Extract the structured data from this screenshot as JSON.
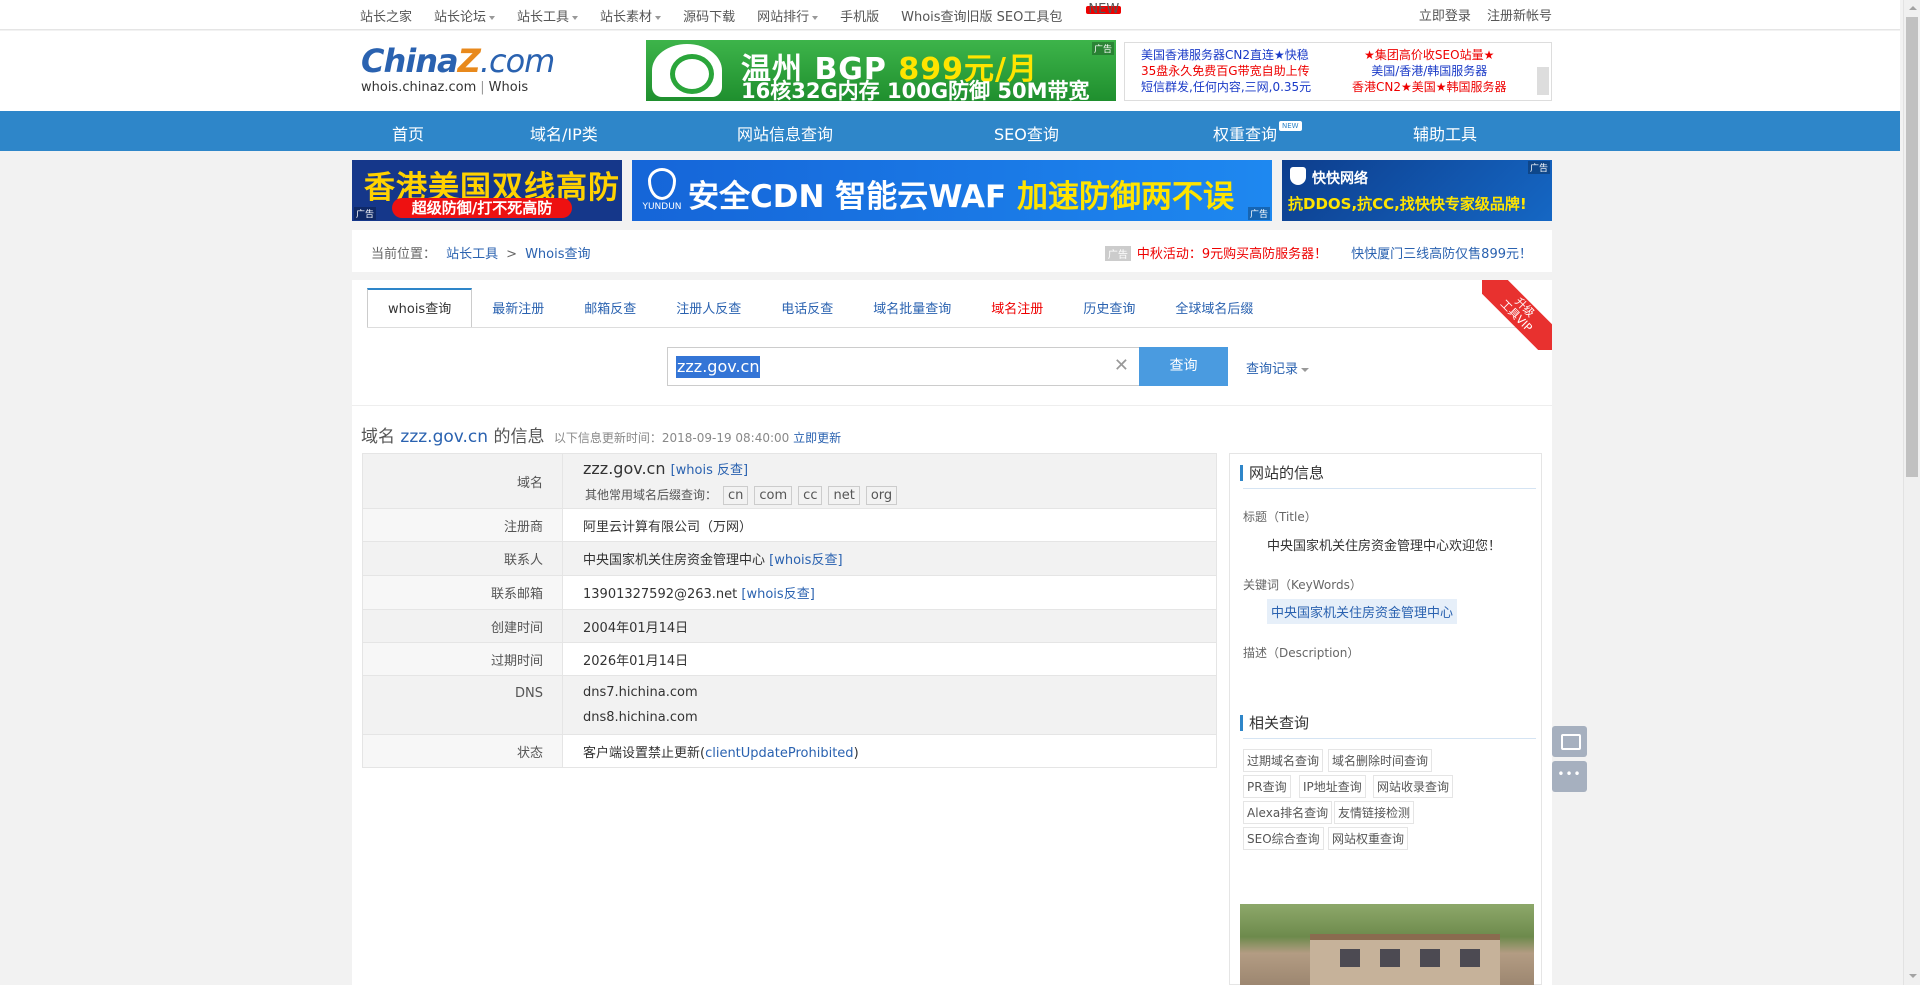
{
  "topbar": {
    "links": [
      {
        "label": "站长之家",
        "dropdown": false
      },
      {
        "label": "站长论坛",
        "dropdown": true
      },
      {
        "label": "站长工具",
        "dropdown": true
      },
      {
        "label": "站长素材",
        "dropdown": true
      },
      {
        "label": "源码下载",
        "dropdown": false
      },
      {
        "label": "网站排行",
        "dropdown": true
      },
      {
        "label": "手机版",
        "dropdown": false
      }
    ],
    "promo_link": "Whois查询旧版 SEO工具包",
    "promo_badge": "NEW",
    "login": "立即登录",
    "register": "注册新帐号"
  },
  "logo": {
    "brand_a": "China",
    "brand_z": "Z",
    "brand_b": ".com",
    "sub_domain": "whois.chinaz.com",
    "sub_sep": "|",
    "sub_name": "Whois"
  },
  "ads": {
    "bgp_title": "温州 BGP",
    "bgp_price": "899元/月",
    "bgp_spec": "16核32G内存 100G防御 50M带宽",
    "bgp_label": "广告",
    "text_col1": [
      "美国香港服务器CN2直连★快稳",
      "35盘永久免费百G带宽自助上传",
      "短信群发,任何内容,三网,0.35元"
    ],
    "text_col2": [
      "★集团高价收SEO站量★",
      "美国/香港/韩国服务器",
      "香港CN2★美国★韩国服务器"
    ],
    "hk_title": "香港美国双线高防",
    "hk_sub": "超级防御/打不死高防",
    "cdn_brand": "YUNDUN",
    "cdn_text": "安全CDN 智能云WAF ",
    "cdn_highlight": "加速防御两不误",
    "kk_brand": "快快网络",
    "kk_text": "抗DDOS,抗CC,找快快专家级品牌!",
    "small_label": "广告"
  },
  "nav": [
    {
      "label": "首页"
    },
    {
      "label": "域名/IP类"
    },
    {
      "label": "网站信息查询"
    },
    {
      "label": "SEO查询"
    },
    {
      "label": "权重查询",
      "badge": "NEW"
    },
    {
      "label": "辅助工具"
    }
  ],
  "breadcrumb": {
    "prefix": "当前位置：",
    "items": [
      "站长工具",
      "Whois查询"
    ],
    "sep": ">",
    "ad_tag": "广告",
    "promo_red": "中秋活动：9元购买高防服务器！",
    "promo_blue": "快快厦门三线高防仅售899元！"
  },
  "tabs": [
    {
      "label": "whois查询",
      "active": true,
      "red": false
    },
    {
      "label": "最新注册",
      "active": false,
      "red": false
    },
    {
      "label": "邮箱反查",
      "active": false,
      "red": false
    },
    {
      "label": "注册人反查",
      "active": false,
      "red": false
    },
    {
      "label": "电话反查",
      "active": false,
      "red": false
    },
    {
      "label": "域名批量查询",
      "active": false,
      "red": false
    },
    {
      "label": "域名注册",
      "active": false,
      "red": true
    },
    {
      "label": "历史查询",
      "active": false,
      "red": false
    },
    {
      "label": "全球域名后缀",
      "active": false,
      "red": false
    }
  ],
  "vip_ribbon": [
    "升级",
    "工具VIP"
  ],
  "search": {
    "value": "zzz.gov.cn",
    "clear": "✕",
    "button": "查询",
    "history": "查询记录"
  },
  "info": {
    "prefix": "域名",
    "domain": "zzz.gov.cn",
    "suffix": "的信息",
    "updated": "以下信息更新时间：2018-09-19 08:40:00",
    "update_now": "立即更新"
  },
  "whois": {
    "domain_label": "域名",
    "domain_value": "zzz.gov.cn",
    "domain_link": "[whois 反查]",
    "other_suffix_label": "其他常用域名后缀查询：",
    "suffixes": [
      "cn",
      "com",
      "cc",
      "net",
      "org"
    ],
    "rows": [
      {
        "key": "注册商",
        "value": "阿里云计算有限公司（万网）",
        "link": ""
      },
      {
        "key": "联系人",
        "value": "中央国家机关住房资金管理中心",
        "link": "[whois反查]"
      },
      {
        "key": "联系邮箱",
        "value": "13901327592@263.net",
        "link": "[whois反查]"
      },
      {
        "key": "创建时间",
        "value": "2004年01月14日",
        "link": ""
      },
      {
        "key": "过期时间",
        "value": "2026年01月14日",
        "link": ""
      }
    ],
    "dns_label": "DNS",
    "dns": [
      "dns7.hichina.com",
      "dns8.hichina.com"
    ],
    "status_label": "状态",
    "status_text": "客户端设置禁止更新(",
    "status_code": "clientUpdateProhibited",
    "status_close": ")"
  },
  "sidebar": {
    "site_info_title": "网站的信息",
    "title_label": "标题（Title）",
    "title_value": "中央国家机关住房资金管理中心欢迎您！",
    "keywords_label": "关键词（KeyWords）",
    "keywords_value": "中央国家机关住房资金管理中心",
    "desc_label": "描述（Description）",
    "related_title": "相关查询",
    "related": [
      "过期域名查询",
      "域名删除时间查询",
      "PR查询",
      "IP地址查询",
      "网站收录查询",
      "Alexa排名查询",
      "友情链接检测",
      "SEO综合查询",
      "网站权重查询"
    ]
  },
  "colors": {
    "nav_blue": "#2e86c9",
    "link_blue": "#2a62b0",
    "red": "#e00000"
  }
}
